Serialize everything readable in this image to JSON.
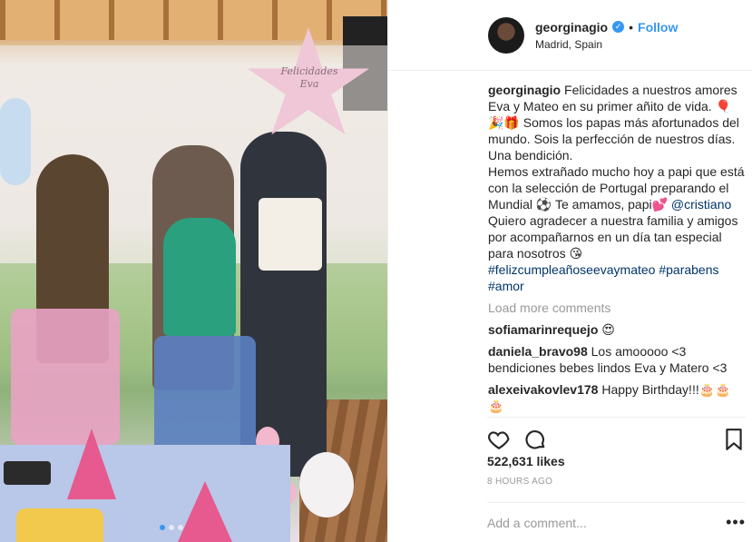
{
  "post": {
    "username": "georginagio",
    "follow_label": "Follow",
    "location": "Madrid, Spain",
    "balloon_text": "Felicidades Eva",
    "caption_user": "georginagio",
    "caption_lines": [
      "Felicidades a nuestros amores Eva y Mateo en su primer añito de vida. 🎈",
      "🎉🎁 Somos los papas más afortunados del mundo. Sois la perfección de nuestros días. Una bendición.",
      "Hemos extrañado mucho hoy a papi que está con la selección de Portugal preparando el Mundial ⚽ Te amamos, papi💕"
    ],
    "mention": "@cristiano",
    "caption_line4": "Quiero agradecer a nuestra familia y amigos por acompañarnos en un día tan especial para nosotros 😘",
    "hashtags": "#felizcumpleañoseevaymateo #parabens #amor",
    "load_more": "Load more comments",
    "comments": [
      {
        "user": "sofiamarinrequejo",
        "text": "😍"
      },
      {
        "user": "daniela_bravo98",
        "text": "Los amooooo <3 bendiciones bebes lindos Eva y Matero <3"
      },
      {
        "user": "alexeivakovlev178",
        "text": "Happy Birthday!!!🎂🎂🎂"
      }
    ],
    "likes": "522,631 likes",
    "time": "8 HOURS AGO",
    "add_comment_placeholder": "Add a comment...",
    "more_icon": "•••"
  },
  "colors": {
    "link_blue": "#3897f0",
    "tag_blue": "#003569",
    "muted": "#999999"
  }
}
